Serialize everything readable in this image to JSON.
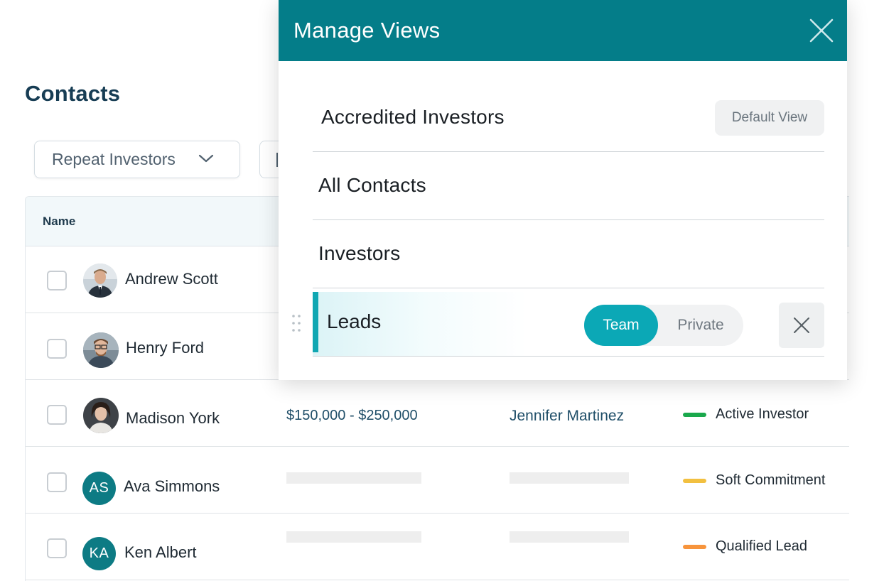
{
  "page": {
    "title": "Contacts",
    "filter_selected": "Repeat Investors"
  },
  "table": {
    "columns": [
      "Name"
    ],
    "rows": [
      {
        "name": "Andrew Scott",
        "avatar": "photo"
      },
      {
        "name": "Henry Ford",
        "avatar": "photo"
      },
      {
        "name": "Madison York",
        "avatar": "photo",
        "amount": "$150,000 - $250,000",
        "owner": "Jennifer Martinez",
        "status": "Active Investor",
        "status_color": "#1aa84c"
      },
      {
        "name": "Ava Simmons",
        "avatar_initials": "AS",
        "status": "Soft Commitment",
        "status_color": "#f2c040"
      },
      {
        "name": "Ken Albert",
        "avatar_initials": "KA",
        "status": "Qualified Lead",
        "status_color": "#f7943c"
      }
    ]
  },
  "modal": {
    "title": "Manage Views",
    "views": [
      {
        "label": "Accredited Investors",
        "badge": "Default View"
      },
      {
        "label": "All Contacts"
      },
      {
        "label": "Investors"
      }
    ],
    "active_view": {
      "label": "Leads",
      "toggle_options": [
        "Team",
        "Private"
      ],
      "toggle_selected": "Team"
    }
  },
  "colors": {
    "brand": "#047d89",
    "accent": "#0ba8b6",
    "title": "#173d54"
  },
  "icons": {
    "dropdown": "chevron-down-icon",
    "modal_close": "close-icon",
    "drag": "drag-handle-icon",
    "remove": "close-icon"
  }
}
